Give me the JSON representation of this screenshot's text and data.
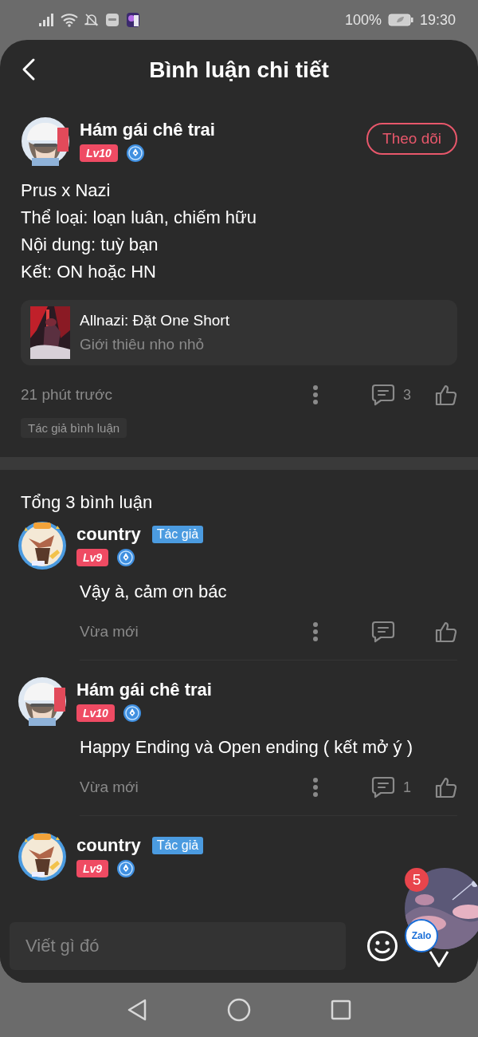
{
  "status_bar": {
    "battery": "100%",
    "time": "19:30"
  },
  "header": {
    "title": "Bình luận chi tiết"
  },
  "post": {
    "author": "Hám gái chê trai",
    "level": "Lv10",
    "follow_button": "Theo dõi",
    "lines": [
      "Prus x Nazi",
      "Thể loại: loạn luân, chiếm hữu",
      "Nội dung: tuỳ bạn",
      "Kết: ON hoặc HN"
    ],
    "book": {
      "title": "Allnazi: Đặt One Short",
      "subtitle": "Giới thiêu nho nhỏ"
    },
    "time": "21 phút trước",
    "reply_count": "3",
    "tag": "Tác giả bình luận"
  },
  "comments_heading": "Tổng 3 bình luận",
  "comments": [
    {
      "author": "country",
      "author_badge": "Tác giả",
      "level": "Lv9",
      "text": "Vậy à, cảm ơn bác",
      "time": "Vừa mới"
    },
    {
      "author": "Hám gái chê trai",
      "level": "Lv10",
      "text": "Happy Ending và Open ending ( kết mở ý )",
      "time": "Vừa mới",
      "reply_count": "1"
    },
    {
      "author": "country",
      "author_badge": "Tác giả",
      "level": "Lv9"
    }
  ],
  "input": {
    "placeholder": "Viết gì đó"
  },
  "chat_bubble": {
    "badge": "5",
    "app_label": "Zalo"
  }
}
